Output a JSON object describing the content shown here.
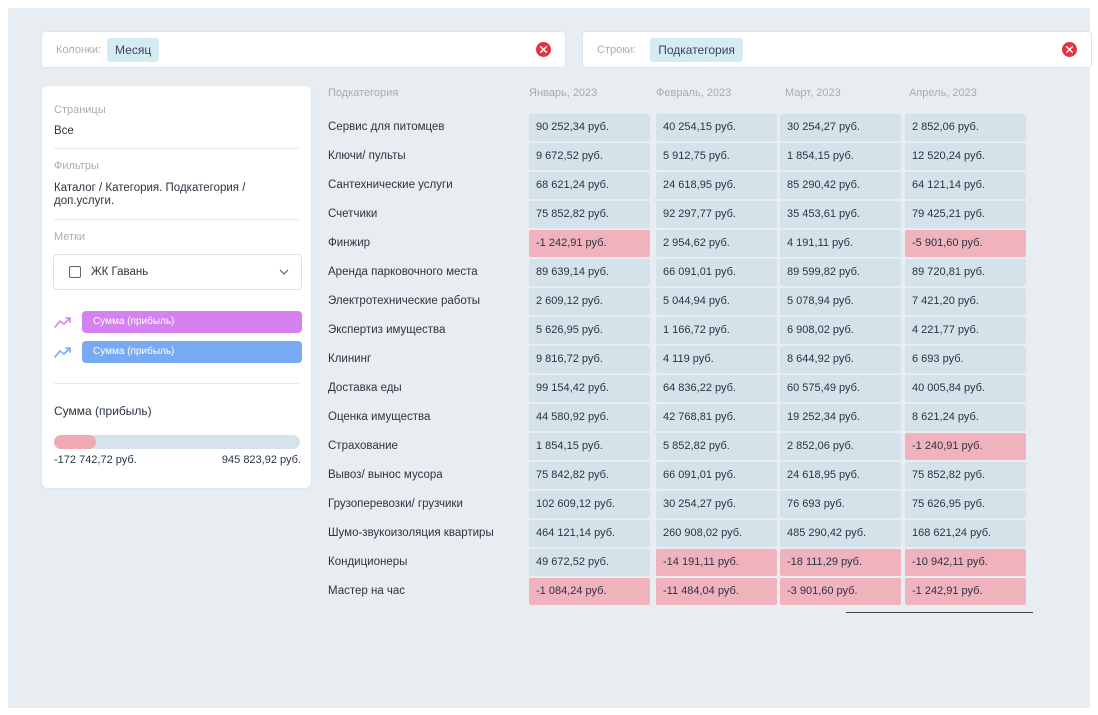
{
  "filters": {
    "columns_label": "Колонки:",
    "columns_chip": "Месяц",
    "rows_label": "Строки:",
    "rows_chip": "Подкатегория"
  },
  "panel": {
    "pages_label": "Страницы",
    "pages_value": "Все",
    "filters_label": "Фильтры",
    "filters_value": "Каталог / Категория. Подкатегория / доп.услуги.",
    "tags_label": "Метки",
    "tag_option": "ЖК Гавань",
    "metrics": [
      {
        "label": "Сумма (прибыль)",
        "color": "#d681f0"
      },
      {
        "label": "Сумма (прибыль)",
        "color": "#78aaf3"
      }
    ],
    "range_title": "Сумма (прибыль)",
    "range_min": "-172 742,72 руб.",
    "range_max": "945 823,92 руб.",
    "range_fill_fraction": 0.17
  },
  "table": {
    "headers": [
      "Подкатегория",
      "Январь, 2023",
      "Февраль, 2023",
      "Март, 2023",
      "Апрель, 2023"
    ],
    "rows": [
      {
        "label": "Сервис для питомцев",
        "values": [
          "90 252,34 руб.",
          "40 254,15 руб.",
          "30 254,27 руб.",
          "2 852,06 руб."
        ]
      },
      {
        "label": "Ключи/ пульты",
        "values": [
          "9 672,52 руб.",
          "5 912,75 руб.",
          "1 854,15 руб.",
          "12 520,24 руб."
        ]
      },
      {
        "label": "Сантехнические услуги",
        "values": [
          "68 621,24 руб.",
          "24 618,95 руб.",
          "85 290,42 руб.",
          "64 121,14 руб."
        ]
      },
      {
        "label": "Счетчики",
        "values": [
          "75 852,82 руб.",
          "92 297,77 руб.",
          "35 453,61 руб.",
          "79 425,21 руб."
        ]
      },
      {
        "label": "Финжир",
        "values": [
          "-1 242,91 руб.",
          "2 954,62 руб.",
          "4 191,11 руб.",
          "-5 901,60 руб."
        ]
      },
      {
        "label": "Аренда парковочного места",
        "values": [
          "89 639,14 руб.",
          "66 091,01 руб.",
          "89 599,82 руб.",
          "89 720,81 руб."
        ]
      },
      {
        "label": "Электротехнические работы",
        "values": [
          "2 609,12 руб.",
          "5 044,94 руб.",
          "5 078,94 руб.",
          "7 421,20 руб."
        ]
      },
      {
        "label": "Экспертиз имущества",
        "values": [
          "5 626,95 руб.",
          "1 166,72 руб.",
          "6 908,02 руб.",
          "4 221,77 руб."
        ]
      },
      {
        "label": "Клининг",
        "values": [
          "9 816,72 руб.",
          "4 119 руб.",
          "8 644,92 руб.",
          "6 693 руб."
        ]
      },
      {
        "label": "Доставка еды",
        "values": [
          "99 154,42 руб.",
          "64 836,22 руб.",
          "60 575,49 руб.",
          "40 005,84 руб."
        ]
      },
      {
        "label": "Оценка имущества",
        "values": [
          "44 580,92 руб.",
          "42 768,81 руб.",
          "19 252,34 руб.",
          "8 621,24 руб."
        ]
      },
      {
        "label": "Страхование",
        "values": [
          "1 854,15 руб.",
          "5 852,82 руб.",
          "2 852,06 руб.",
          "-1 240,91 руб."
        ]
      },
      {
        "label": "Вывоз/ вынос мусора",
        "values": [
          "75 842,82 руб.",
          "66 091,01 руб.",
          "24 618,95 руб.",
          "75 852,82 руб."
        ]
      },
      {
        "label": "Грузоперевозки/ грузчики",
        "values": [
          "102 609,12 руб.",
          "30 254,27 руб.",
          "76 693 руб.",
          "75 626,95 руб."
        ]
      },
      {
        "label": "Шумо-звукоизоляция квартиры",
        "values": [
          "464 121,14 руб.",
          "260 908,02 руб.",
          "485 290,42 руб.",
          "168 621,24 руб."
        ]
      },
      {
        "label": "Кондиционеры",
        "values": [
          "49 672,52 руб.",
          "-14 191,11 руб.",
          "-18 111,29 руб.",
          "-10 942,11 руб."
        ]
      },
      {
        "label": "Мастер на час",
        "values": [
          "-1 084,24 руб.",
          "-11 484,04 руб.",
          "-3 901,60 руб.",
          "-1 242,91 руб."
        ]
      }
    ]
  },
  "colors": {
    "positive_cell": "#d5e2ea",
    "negative_cell": "#f0b3bd",
    "clear_button": "#e2343e",
    "chip": "#d6eaf2"
  }
}
